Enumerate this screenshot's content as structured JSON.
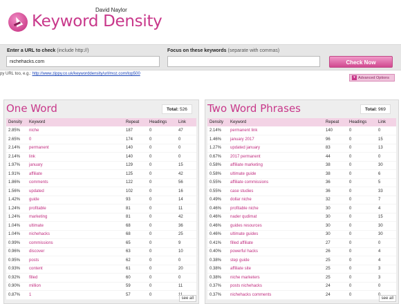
{
  "header": {
    "title": "Keyword Density",
    "author": "David Naylor"
  },
  "form": {
    "url_label": "Enter a URL to check",
    "url_hint": "(include http://)",
    "url_value": "nichehacks.com",
    "focus_label": "Focus on these keywords",
    "focus_hint": "(separate with commas)",
    "focus_value": "",
    "check_button": "Check Now",
    "example_prefix": "py URL too, e.g.:",
    "example_link": "http://www.zippy.co.uk/keyworddensity/url/moz.com/top500",
    "advanced_button": "Advanced Options"
  },
  "one_word": {
    "title": "One Word",
    "total_label": "Total:",
    "total_value": "526",
    "columns": [
      "Density",
      "Keyword",
      "Repeat",
      "Headings",
      "Link"
    ],
    "rows": [
      [
        "2.85%",
        "niche",
        "187",
        "0",
        "47"
      ],
      [
        "2.65%",
        "0",
        "174",
        "0",
        "0"
      ],
      [
        "2.14%",
        "permanent",
        "140",
        "0",
        "0"
      ],
      [
        "2.14%",
        "link",
        "140",
        "0",
        "0"
      ],
      [
        "1.97%",
        "january",
        "129",
        "0",
        "15"
      ],
      [
        "1.91%",
        "affiliate",
        "125",
        "0",
        "42"
      ],
      [
        "1.86%",
        "comments",
        "122",
        "0",
        "56"
      ],
      [
        "1.56%",
        "updated",
        "102",
        "0",
        "16"
      ],
      [
        "1.42%",
        "guide",
        "93",
        "0",
        "14"
      ],
      [
        "1.24%",
        "profitable",
        "81",
        "0",
        "11"
      ],
      [
        "1.24%",
        "marketing",
        "81",
        "0",
        "42"
      ],
      [
        "1.04%",
        "ultimate",
        "68",
        "0",
        "36"
      ],
      [
        "1.04%",
        "nichehacks",
        "68",
        "0",
        "25"
      ],
      [
        "0.99%",
        "commissions",
        "65",
        "0",
        "9"
      ],
      [
        "0.96%",
        "discover",
        "63",
        "0",
        "10"
      ],
      [
        "0.95%",
        "posts",
        "62",
        "0",
        "0"
      ],
      [
        "0.93%",
        "content",
        "61",
        "0",
        "20"
      ],
      [
        "0.92%",
        "filled",
        "60",
        "0",
        "0"
      ],
      [
        "0.90%",
        "million",
        "59",
        "0",
        "11"
      ],
      [
        "0.87%",
        "1",
        "57",
        "0",
        "11"
      ]
    ],
    "see_all": "see all"
  },
  "two_word": {
    "title": "Two Word Phrases",
    "total_label": "Total:",
    "total_value": "969",
    "columns": [
      "Density",
      "Keyword",
      "Repeat",
      "Headings",
      "Link"
    ],
    "rows": [
      [
        "2.14%",
        "permanent link",
        "140",
        "0",
        "0"
      ],
      [
        "1.46%",
        "january 2017",
        "96",
        "0",
        "15"
      ],
      [
        "1.27%",
        "updated january",
        "83",
        "0",
        "13"
      ],
      [
        "0.67%",
        "2017 permanent",
        "44",
        "0",
        "0"
      ],
      [
        "0.58%",
        "affiliate marketing",
        "38",
        "0",
        "30"
      ],
      [
        "0.58%",
        "ultimate guide",
        "38",
        "0",
        "6"
      ],
      [
        "0.55%",
        "affiliate commissions",
        "36",
        "0",
        "5"
      ],
      [
        "0.55%",
        "case studies",
        "36",
        "0",
        "33"
      ],
      [
        "0.49%",
        "dollar niche",
        "32",
        "0",
        "7"
      ],
      [
        "0.46%",
        "profitable niche",
        "30",
        "0",
        "4"
      ],
      [
        "0.46%",
        "nader qudimat",
        "30",
        "0",
        "15"
      ],
      [
        "0.46%",
        "guides resources",
        "30",
        "0",
        "30"
      ],
      [
        "0.46%",
        "ultimate guides",
        "30",
        "0",
        "30"
      ],
      [
        "0.41%",
        "filled affiliate",
        "27",
        "0",
        "0"
      ],
      [
        "0.40%",
        "powerful hacks",
        "26",
        "0",
        "4"
      ],
      [
        "0.38%",
        "step guide",
        "25",
        "0",
        "4"
      ],
      [
        "0.38%",
        "affiliate site",
        "25",
        "0",
        "3"
      ],
      [
        "0.38%",
        "niche marketers",
        "25",
        "0",
        "3"
      ],
      [
        "0.37%",
        "posts nichehacks",
        "24",
        "0",
        "0"
      ],
      [
        "0.37%",
        "nichehacks comments",
        "24",
        "0",
        "0"
      ]
    ],
    "see_all": "see all"
  },
  "colors": {
    "accent": "#c8378a",
    "header_row": "#f3d3e5",
    "panel_bg": "#eeeeee"
  }
}
